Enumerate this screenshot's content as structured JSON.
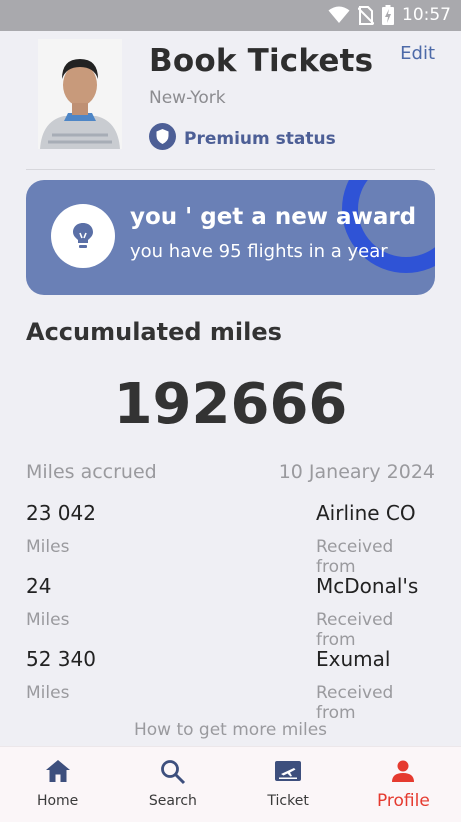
{
  "status_bar": {
    "time": "10:57",
    "icons": [
      "wifi-icon",
      "no-sim-icon",
      "battery-charging-icon"
    ]
  },
  "profile": {
    "title": "Book Tickets",
    "edit_label": "Edit",
    "city": "New-York",
    "status_label": "Premium status",
    "status_icon": "shield-icon"
  },
  "award": {
    "title": "you ' get a new award",
    "subtitle": "you have 95 flights in a year",
    "icon": "lightbulb-icon",
    "bg_color": "#6a80b6",
    "accent_color": "#2f53d6"
  },
  "miles": {
    "section_title": "Accumulated miles",
    "total": "192666",
    "accrued_label": "Miles accrued",
    "date": "10 Janeary 2024",
    "entries": [
      {
        "amount": "23 042",
        "unit": "Miles",
        "source": "Airline CO",
        "source_label": "Received from"
      },
      {
        "amount": "24",
        "unit": "Miles",
        "source": "McDonal's",
        "source_label": "Received from"
      },
      {
        "amount": "52 340",
        "unit": "Miles",
        "source": "Exumal",
        "source_label": "Received from"
      }
    ],
    "more_link": "How to get more miles"
  },
  "nav": {
    "items": [
      {
        "label": "Home",
        "icon": "home-icon"
      },
      {
        "label": "Search",
        "icon": "search-icon"
      },
      {
        "label": "Ticket",
        "icon": "ticket-icon"
      },
      {
        "label": "Profile",
        "icon": "person-icon"
      }
    ],
    "active": "Profile",
    "active_color": "#e53a2f"
  }
}
